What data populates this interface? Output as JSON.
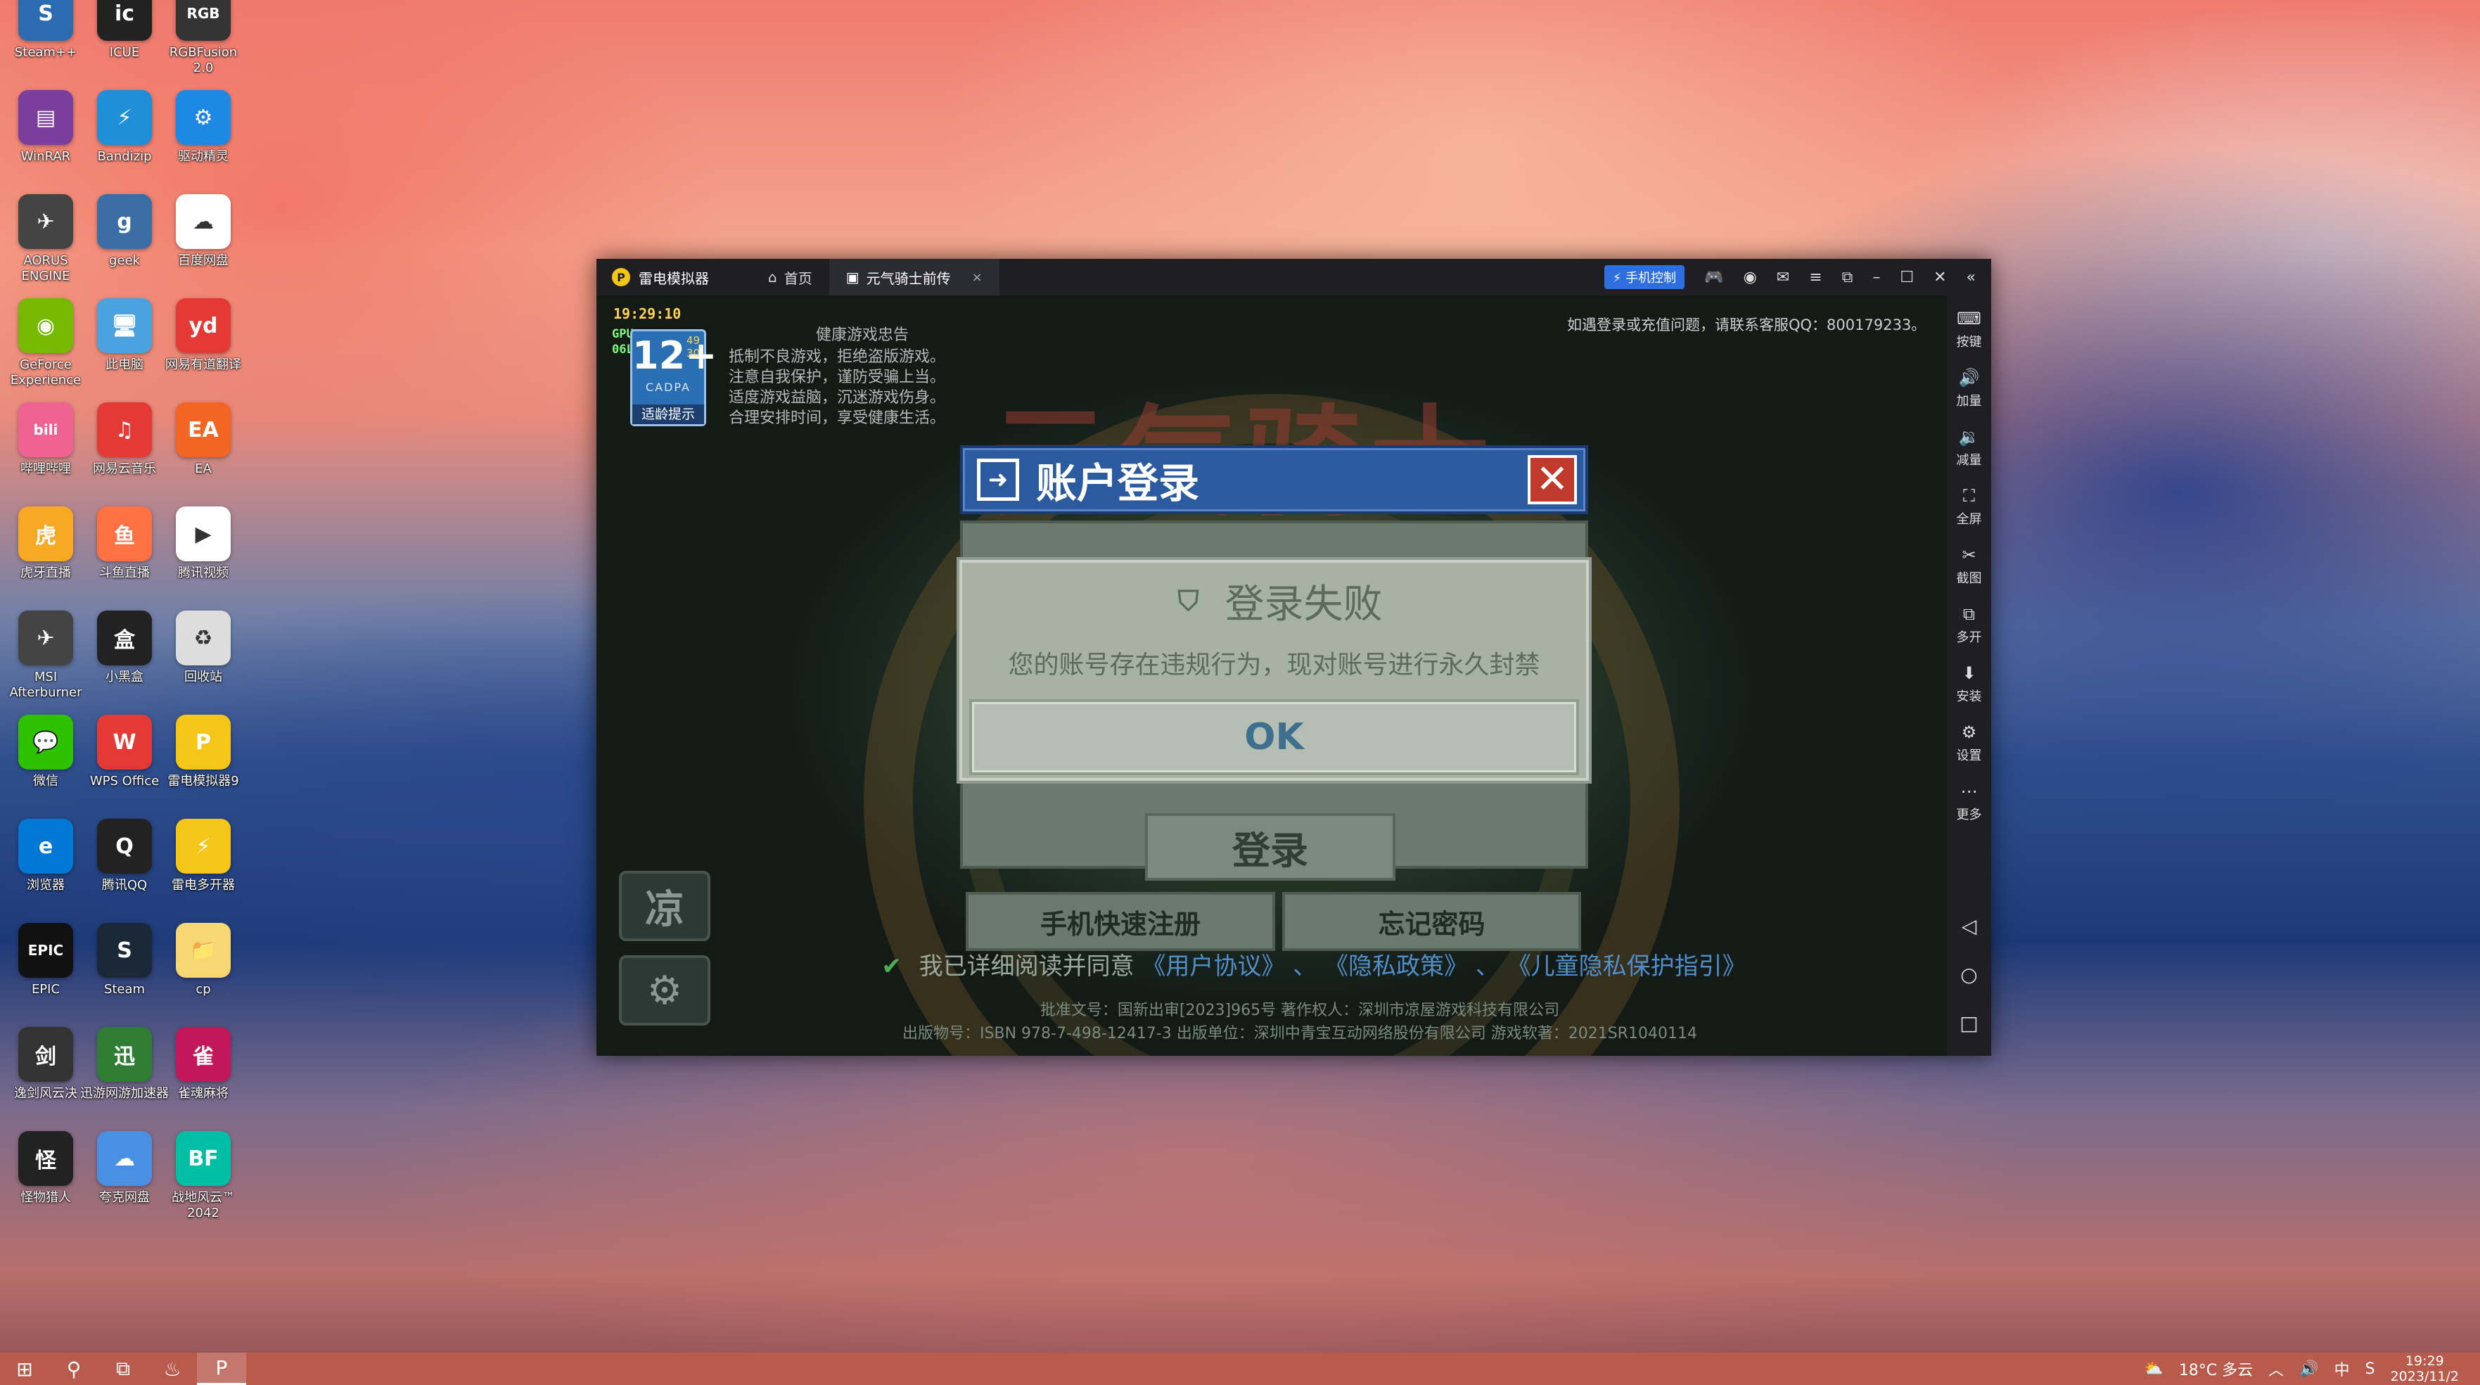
{
  "desktop": {
    "icons": [
      {
        "label": "Steam++",
        "color": "#2b6cb0",
        "glyph": "S"
      },
      {
        "label": "ICUE",
        "color": "#222",
        "glyph": "ic"
      },
      {
        "label": "RGBFusion 2.0",
        "color": "#333",
        "glyph": "RGB"
      },
      {
        "label": "WinRAR",
        "color": "#7a3f9d",
        "glyph": "▤"
      },
      {
        "label": "Bandizip",
        "color": "#1f8fd8",
        "glyph": "⚡"
      },
      {
        "label": "驱动精灵",
        "color": "#1e88e5",
        "glyph": "⚙"
      },
      {
        "label": "AORUS ENGINE",
        "color": "#444",
        "glyph": "✈"
      },
      {
        "label": "geek",
        "color": "#3a6ea5",
        "glyph": "g"
      },
      {
        "label": "百度网盘",
        "color": "#fff",
        "glyph": "☁"
      },
      {
        "label": "GeForce Experience",
        "color": "#76b900",
        "glyph": "◉"
      },
      {
        "label": "此电脑",
        "color": "#4aa3df",
        "glyph": "🖥"
      },
      {
        "label": "网易有道翻译",
        "color": "#e53935",
        "glyph": "yd"
      },
      {
        "label": "哔哩哔哩",
        "color": "#f06292",
        "glyph": "bili"
      },
      {
        "label": "网易云音乐",
        "color": "#e53935",
        "glyph": "♫"
      },
      {
        "label": "EA",
        "color": "#f26522",
        "glyph": "EA"
      },
      {
        "label": "虎牙直播",
        "color": "#f9a825",
        "glyph": "虎"
      },
      {
        "label": "斗鱼直播",
        "color": "#ff7043",
        "glyph": "鱼"
      },
      {
        "label": "腾讯视频",
        "color": "#fff",
        "glyph": "▶"
      },
      {
        "label": "MSI Afterburner",
        "color": "#444",
        "glyph": "✈"
      },
      {
        "label": "小黑盒",
        "color": "#222",
        "glyph": "盒"
      },
      {
        "label": "回收站",
        "color": "#ddd",
        "glyph": "♻"
      },
      {
        "label": "微信",
        "color": "#2dc100",
        "glyph": "💬"
      },
      {
        "label": "WPS Office",
        "color": "#e53935",
        "glyph": "W"
      },
      {
        "label": "雷电模拟器9",
        "color": "#f5c518",
        "glyph": "P"
      },
      {
        "label": "浏览器",
        "color": "#0078d4",
        "glyph": "e"
      },
      {
        "label": "腾讯QQ",
        "color": "#222",
        "glyph": "Q"
      },
      {
        "label": "雷电多开器",
        "color": "#f5c518",
        "glyph": "⚡"
      },
      {
        "label": "EPIC",
        "color": "#111",
        "glyph": "EPIC"
      },
      {
        "label": "Steam",
        "color": "#1b2838",
        "glyph": "S"
      },
      {
        "label": "cp",
        "color": "#f7d774",
        "glyph": "📁"
      },
      {
        "label": "逸剑风云决",
        "color": "#333",
        "glyph": "剑"
      },
      {
        "label": "迅游网游加速器",
        "color": "#2e7d32",
        "glyph": "迅"
      },
      {
        "label": "雀魂麻将",
        "color": "#c2185b",
        "glyph": "雀"
      },
      {
        "label": "怪物猎人",
        "color": "#222",
        "glyph": "怪"
      },
      {
        "label": "夸克网盘",
        "color": "#4a90e2",
        "glyph": "☁"
      },
      {
        "label": "战地风云™ 2042",
        "color": "#00bfa5",
        "glyph": "BF"
      }
    ]
  },
  "emulator": {
    "app_name": "雷电模拟器",
    "tab_home": "首页",
    "tab_game": "元气骑士前传",
    "phone_control": "手机控制",
    "sidebar": [
      {
        "icon": "keyboard-icon",
        "glyph": "⌨",
        "label": "按键"
      },
      {
        "icon": "volume-up-icon",
        "glyph": "🔊",
        "label": "加量"
      },
      {
        "icon": "volume-down-icon",
        "glyph": "🔉",
        "label": "减量"
      },
      {
        "icon": "fullscreen-icon",
        "glyph": "⛶",
        "label": "全屏"
      },
      {
        "icon": "scissors-icon",
        "glyph": "✂",
        "label": "截图"
      },
      {
        "icon": "multi-instance-icon",
        "glyph": "⧉",
        "label": "多开"
      },
      {
        "icon": "install-icon",
        "glyph": "⬇",
        "label": "安装"
      },
      {
        "icon": "settings-icon",
        "glyph": "⚙",
        "label": "设置"
      },
      {
        "icon": "more-icon",
        "glyph": "⋯",
        "label": "更多"
      }
    ]
  },
  "game": {
    "clock": "19:29:10",
    "fps_label_gpu": "GPU",
    "fps_label_cpu": "06L",
    "fps_val1": "49",
    "fps_val2": "30",
    "age_rating": "12+",
    "cadpa": "CADPA",
    "age_tip": "适龄提示",
    "health_title": "健康游戏忠告",
    "health_lines": [
      "抵制不良游戏，拒绝盗版游戏。",
      "注意自我保护，谨防受骗上当。",
      "适度游戏益脑，沉迷游戏伤身。",
      "合理安排时间，享受健康生活。"
    ],
    "notice": "如遇登录或充值问题，请联系客服QQ：800179233。",
    "splash_title": "元气骑士",
    "login_title": "账户登录",
    "login_button": "登录",
    "register_button": "手机快速注册",
    "forgot_button": "忘记密码",
    "agree_text": "我已详细阅读并同意",
    "link_user": "《用户协议》",
    "link_privacy": "《隐私政策》",
    "link_child": "《儿童隐私保护指引》",
    "sep": "、",
    "credit1": "批准文号：国新出审[2023]965号  著作权人：深圳市凉屋游戏科技有限公司",
    "credit2": "出版物号：ISBN 978-7-498-12417-3    出版单位：深圳中青宝互动网络股份有限公司    游戏软著：2021SR1040114",
    "side_btn1": "凉",
    "side_btn2": "⚙",
    "fail_title": "登录失败",
    "fail_message": "您的账号存在违规行为，现对账号进行永久封禁",
    "ok_button": "OK"
  },
  "taskbar": {
    "weather": "18°C  多云",
    "ime": "中",
    "time": "19:29",
    "date": "2023/11/2"
  }
}
